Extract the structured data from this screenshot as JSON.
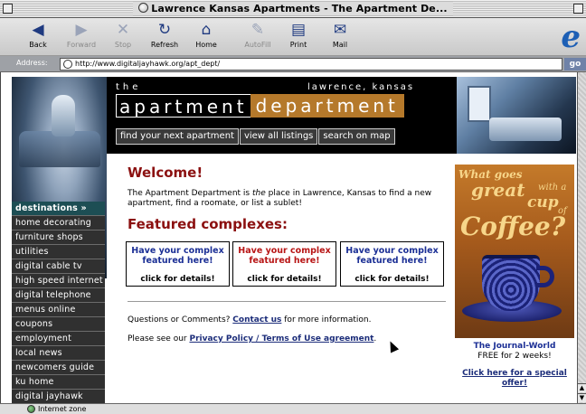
{
  "window": {
    "title": "Lawrence Kansas Apartments - The Apartment De..."
  },
  "toolbar": {
    "buttons": [
      {
        "label": "Back",
        "icon": "back-arrow-icon",
        "enabled": true
      },
      {
        "label": "Forward",
        "icon": "forward-arrow-icon",
        "enabled": false
      },
      {
        "label": "Stop",
        "icon": "stop-x-icon",
        "enabled": false
      },
      {
        "label": "Refresh",
        "icon": "refresh-icon",
        "enabled": true
      },
      {
        "label": "Home",
        "icon": "home-icon",
        "enabled": true
      },
      {
        "label": "AutoFill",
        "icon": "autofill-icon",
        "enabled": false
      },
      {
        "label": "Print",
        "icon": "printer-icon",
        "enabled": true
      },
      {
        "label": "Mail",
        "icon": "mail-icon",
        "enabled": true
      }
    ],
    "logo": "e"
  },
  "address": {
    "label": "Address:",
    "url": "http://www.digitaljayhawk.org/apt_dept/",
    "go": "go"
  },
  "header": {
    "the": "the",
    "city": "lawrence, kansas",
    "brand_left": "apartment",
    "brand_right": "department",
    "nav": [
      "find your next apartment",
      "view all listings",
      "search on map"
    ]
  },
  "sidebar": {
    "items": [
      "destinations »",
      "home decorating",
      "furniture shops",
      "utilities",
      "digital cable tv",
      "high speed internet",
      "digital telephone",
      "menus online",
      "coupons",
      "employment",
      "local news",
      "newcomers guide",
      "ku home",
      "digital jayhawk"
    ]
  },
  "main": {
    "welcome": "Welcome!",
    "intro_pre": "The Apartment Department is ",
    "intro_em": "the",
    "intro_post": " place in Lawrence, Kansas to find a new apartment, find a roomate, or list a sublet!",
    "featured_title": "Featured complexes:",
    "featured": [
      {
        "title": "Have your complex featured here!",
        "details": "click for details!",
        "color": "#1b2f95"
      },
      {
        "title": "Have your complex featured here!",
        "details": "click for details!",
        "color": "#b81515"
      },
      {
        "title": "Have your complex featured here!",
        "details": "click for details!",
        "color": "#1b2f95"
      }
    ],
    "questions_pre": "Questions or Comments? ",
    "questions_link": "Contact us",
    "questions_post": " for more information.",
    "privacy_pre": "Please see our ",
    "privacy_link": "Privacy Policy / Terms of Use agreement",
    "privacy_post": "."
  },
  "ad": {
    "line1": "What goes",
    "great": "great",
    "with": "with a",
    "cup": "cup",
    "of": "of",
    "coffee": "Coffee?",
    "jw_name": "The Journal-World",
    "jw_offer": "FREE for 2 weeks!",
    "special": "Click here for a special offer!"
  },
  "status": {
    "zone": "Internet zone"
  },
  "colors": {
    "heading_red": "#8b1010",
    "brand_orange": "#b5792b",
    "link_blue": "#1c2d7a",
    "sidebar_dark": "#303030",
    "sidebar_head": "#1d4e54"
  }
}
